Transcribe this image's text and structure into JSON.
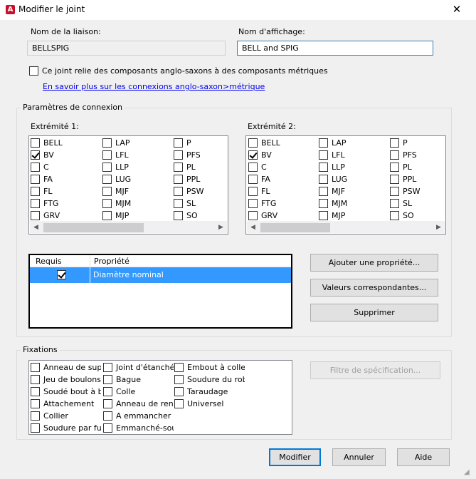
{
  "window": {
    "title": "Modifier le joint",
    "app_icon_glyph": "A",
    "close_glyph": "✕"
  },
  "liaison": {
    "label": "Nom de la liaison:",
    "value": "BELLSPIG"
  },
  "affichage": {
    "label": "Nom d'affichage:",
    "value": "BELL and SPIG"
  },
  "metric_option": {
    "label": "Ce joint relie des composants anglo-saxons à des composants métriques",
    "checked": false,
    "link": "En savoir plus sur les connexions anglo-saxon>métrique"
  },
  "connexion": {
    "title": "Paramètres de connexion",
    "end1": {
      "label": "Extrémité 1:",
      "columns": [
        [
          {
            "t": "BELL",
            "c": false
          },
          {
            "t": "BV",
            "c": true
          },
          {
            "t": "C",
            "c": false
          },
          {
            "t": "FA",
            "c": false
          },
          {
            "t": "FL",
            "c": false
          },
          {
            "t": "FTG",
            "c": false
          },
          {
            "t": "GRV",
            "c": false
          }
        ],
        [
          {
            "t": "LAP",
            "c": false
          },
          {
            "t": "LFL",
            "c": false
          },
          {
            "t": "LLP",
            "c": false
          },
          {
            "t": "LUG",
            "c": false
          },
          {
            "t": "MJF",
            "c": false
          },
          {
            "t": "MJM",
            "c": false
          },
          {
            "t": "MJP",
            "c": false
          }
        ],
        [
          {
            "t": "P",
            "c": false
          },
          {
            "t": "PFS",
            "c": false
          },
          {
            "t": "PL",
            "c": false
          },
          {
            "t": "PPL",
            "c": false
          },
          {
            "t": "PSW",
            "c": false
          },
          {
            "t": "SL",
            "c": false
          },
          {
            "t": "SO",
            "c": false
          }
        ]
      ]
    },
    "end2": {
      "label": "Extrémité 2:",
      "columns": [
        [
          {
            "t": "BELL",
            "c": false
          },
          {
            "t": "BV",
            "c": true
          },
          {
            "t": "C",
            "c": false
          },
          {
            "t": "FA",
            "c": false
          },
          {
            "t": "FL",
            "c": false
          },
          {
            "t": "FTG",
            "c": false
          },
          {
            "t": "GRV",
            "c": false
          }
        ],
        [
          {
            "t": "LAP",
            "c": false
          },
          {
            "t": "LFL",
            "c": false
          },
          {
            "t": "LLP",
            "c": false
          },
          {
            "t": "LUG",
            "c": false
          },
          {
            "t": "MJF",
            "c": false
          },
          {
            "t": "MJM",
            "c": false
          },
          {
            "t": "MJP",
            "c": false
          }
        ],
        [
          {
            "t": "P",
            "c": false
          },
          {
            "t": "PFS",
            "c": false
          },
          {
            "t": "PL",
            "c": false
          },
          {
            "t": "PPL",
            "c": false
          },
          {
            "t": "PSW",
            "c": false
          },
          {
            "t": "SL",
            "c": false
          },
          {
            "t": "SO",
            "c": false
          }
        ]
      ]
    },
    "grid": {
      "col_required": "Requis",
      "col_property": "Propriété",
      "rows": [
        {
          "required": true,
          "property": "Diamètre nominal",
          "selected": true
        }
      ]
    },
    "buttons": {
      "add": "Ajouter une propriété...",
      "values": "Valeurs correspondantes...",
      "delete": "Supprimer"
    }
  },
  "fixations": {
    "title": "Fixations",
    "columns": [
      [
        {
          "t": "Anneau de support",
          "c": false
        },
        {
          "t": "Jeu de boulons",
          "c": false
        },
        {
          "t": "Soudé bout à bout",
          "c": false
        },
        {
          "t": "Attachement",
          "c": false
        },
        {
          "t": "Collier",
          "c": false
        },
        {
          "t": "Soudure par fusion",
          "c": false
        }
      ],
      [
        {
          "t": "Joint d'étanchéité",
          "c": false
        },
        {
          "t": "Bague",
          "c": false
        },
        {
          "t": "Colle",
          "c": false
        },
        {
          "t": "Anneau de renfort",
          "c": false
        },
        {
          "t": "A emmancher",
          "c": false
        },
        {
          "t": "Emmanché-soudé",
          "c": false
        }
      ],
      [
        {
          "t": "Embout à collet",
          "c": false
        },
        {
          "t": "Soudure du robinet",
          "c": false
        },
        {
          "t": "Taraudage",
          "c": false
        },
        {
          "t": "Universel",
          "c": false
        }
      ]
    ],
    "filter_button": "Filtre de spécification..."
  },
  "footer": {
    "ok": "Modifier",
    "cancel": "Annuler",
    "help": "Aide"
  },
  "colors": {
    "selection": "#3399ff",
    "default_button_border": "#0078d7",
    "link": "#0000ee"
  }
}
